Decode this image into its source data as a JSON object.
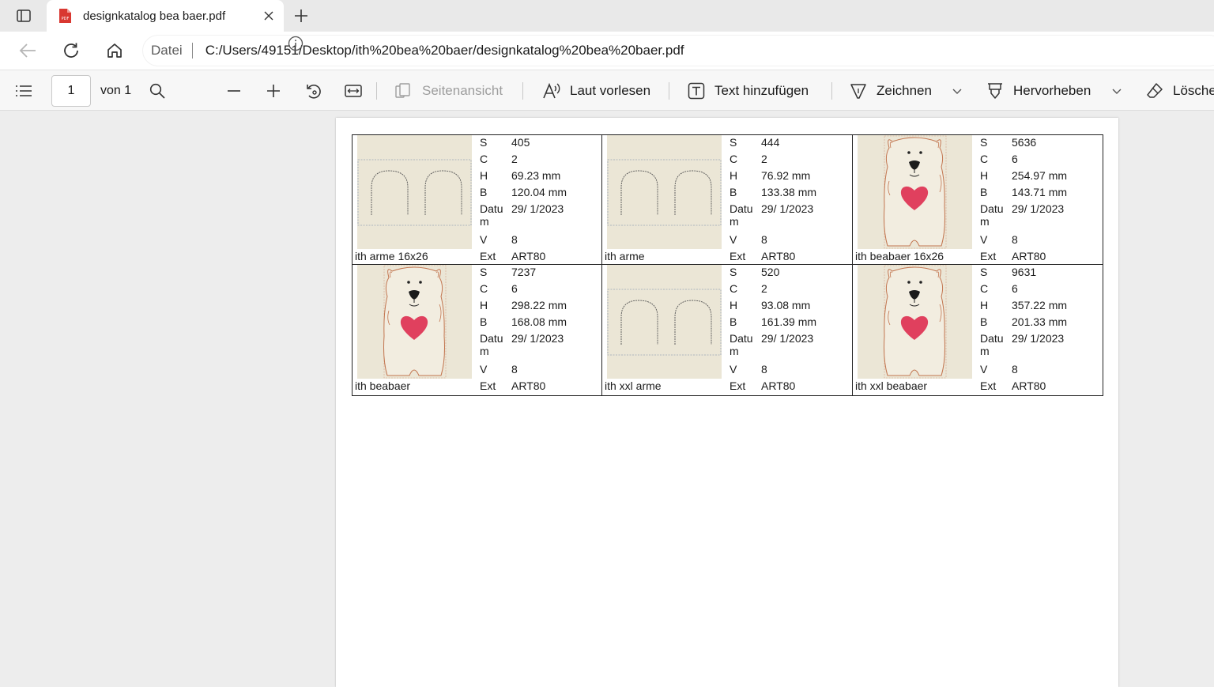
{
  "browser": {
    "tab_title": "designkatalog bea baer.pdf",
    "address_scheme": "Datei",
    "address_url": "C:/Users/49151/Desktop/ith%20bea%20baer/designkatalog%20bea%20baer.pdf"
  },
  "toolbar": {
    "page_number": "1",
    "page_total": "von 1",
    "page_view_label": "Seitenansicht",
    "read_aloud_label": "Laut vorlesen",
    "add_text_label": "Text hinzufügen",
    "draw_label": "Zeichnen",
    "highlight_label": "Hervorheben",
    "erase_label": "Lösche"
  },
  "catalog": {
    "field_labels": {
      "s": "S",
      "c": "C",
      "h": "H",
      "b": "B",
      "datum": "Datum",
      "v": "V",
      "ext": "Ext"
    },
    "designs": [
      {
        "name": "ith arme 16x26",
        "thumb": "arms",
        "s": "405",
        "c": "2",
        "h": "69.23 mm",
        "b": "120.04 mm",
        "datum": "29/ 1/2023",
        "v": "8",
        "ext": "ART80"
      },
      {
        "name": "ith arme",
        "thumb": "arms",
        "s": "444",
        "c": "2",
        "h": "76.92 mm",
        "b": "133.38 mm",
        "datum": "29/ 1/2023",
        "v": "8",
        "ext": "ART80"
      },
      {
        "name": "ith beabaer 16x26",
        "thumb": "bear",
        "s": "5636",
        "c": "6",
        "h": "254.97 mm",
        "b": "143.71 mm",
        "datum": "29/ 1/2023",
        "v": "8",
        "ext": "ART80"
      },
      {
        "name": "ith beabaer",
        "thumb": "bear",
        "s": "7237",
        "c": "6",
        "h": "298.22 mm",
        "b": "168.08 mm",
        "datum": "29/ 1/2023",
        "v": "8",
        "ext": "ART80"
      },
      {
        "name": "ith xxl arme",
        "thumb": "arms",
        "s": "520",
        "c": "2",
        "h": "93.08 mm",
        "b": "161.39 mm",
        "datum": "29/ 1/2023",
        "v": "8",
        "ext": "ART80"
      },
      {
        "name": "ith xxl beabaer",
        "thumb": "bear",
        "s": "9631",
        "c": "6",
        "h": "357.22 mm",
        "b": "201.33 mm",
        "datum": "29/ 1/2023",
        "v": "8",
        "ext": "ART80"
      }
    ]
  },
  "colors": {
    "heart": "#e0405e",
    "fabric": "#ebe6d6",
    "bear_outline": "#c2754f"
  }
}
